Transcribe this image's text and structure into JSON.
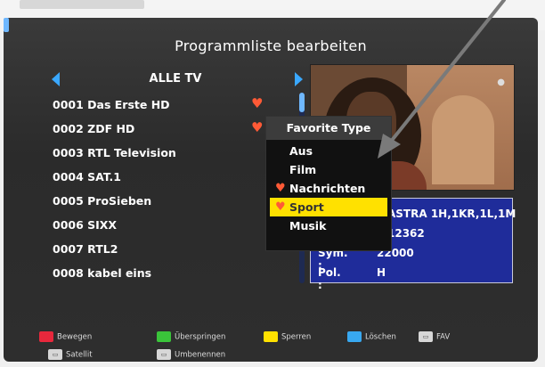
{
  "screen": {
    "title": "Programmliste bearbeiten",
    "list_header": "ALLE TV"
  },
  "channels": [
    {
      "label": "0001 Das Erste HD",
      "favorite": true
    },
    {
      "label": "0002 ZDF HD",
      "favorite": true
    },
    {
      "label": "0003 RTL Television",
      "favorite": false
    },
    {
      "label": "0004 SAT.1",
      "favorite": false
    },
    {
      "label": "0005 ProSieben",
      "favorite": false
    },
    {
      "label": "0006 SIXX",
      "favorite": false
    },
    {
      "label": "0007 RTL2",
      "favorite": false
    },
    {
      "label": "0008 kabel eins",
      "favorite": false
    }
  ],
  "popup": {
    "title": "Favorite Type",
    "items": [
      {
        "label": "Aus",
        "favorite": false,
        "selected": false
      },
      {
        "label": "Film",
        "favorite": false,
        "selected": false
      },
      {
        "label": "Nachrichten",
        "favorite": true,
        "selected": false
      },
      {
        "label": "Sport",
        "favorite": true,
        "selected": true
      },
      {
        "label": "Musik",
        "favorite": false,
        "selected": false
      }
    ]
  },
  "info": {
    "sat_value": "ASTRA 1H,1KR,1L,1M",
    "freq_value": "12362",
    "sym_label": "Sym. :",
    "sym_value": "22000",
    "pol_label": "Pol. :",
    "pol_value": "H"
  },
  "legend": {
    "move": "Bewegen",
    "skip": "Überspringen",
    "lock": "Sperren",
    "delete": "Löschen",
    "fav": "FAV",
    "satellite": "Satellit",
    "rename": "Umbenennen"
  },
  "colors": {
    "red_key": "#e8283c",
    "green_key": "#3ac43a",
    "yellow_key": "#ffe100",
    "blue_key": "#38a8f0",
    "heart": "#ff5a36",
    "info_bg": "#1f2c9a"
  },
  "icons": {
    "favorite": "heart-icon",
    "nav_left": "triangle-left-icon",
    "nav_right": "triangle-right-icon"
  }
}
